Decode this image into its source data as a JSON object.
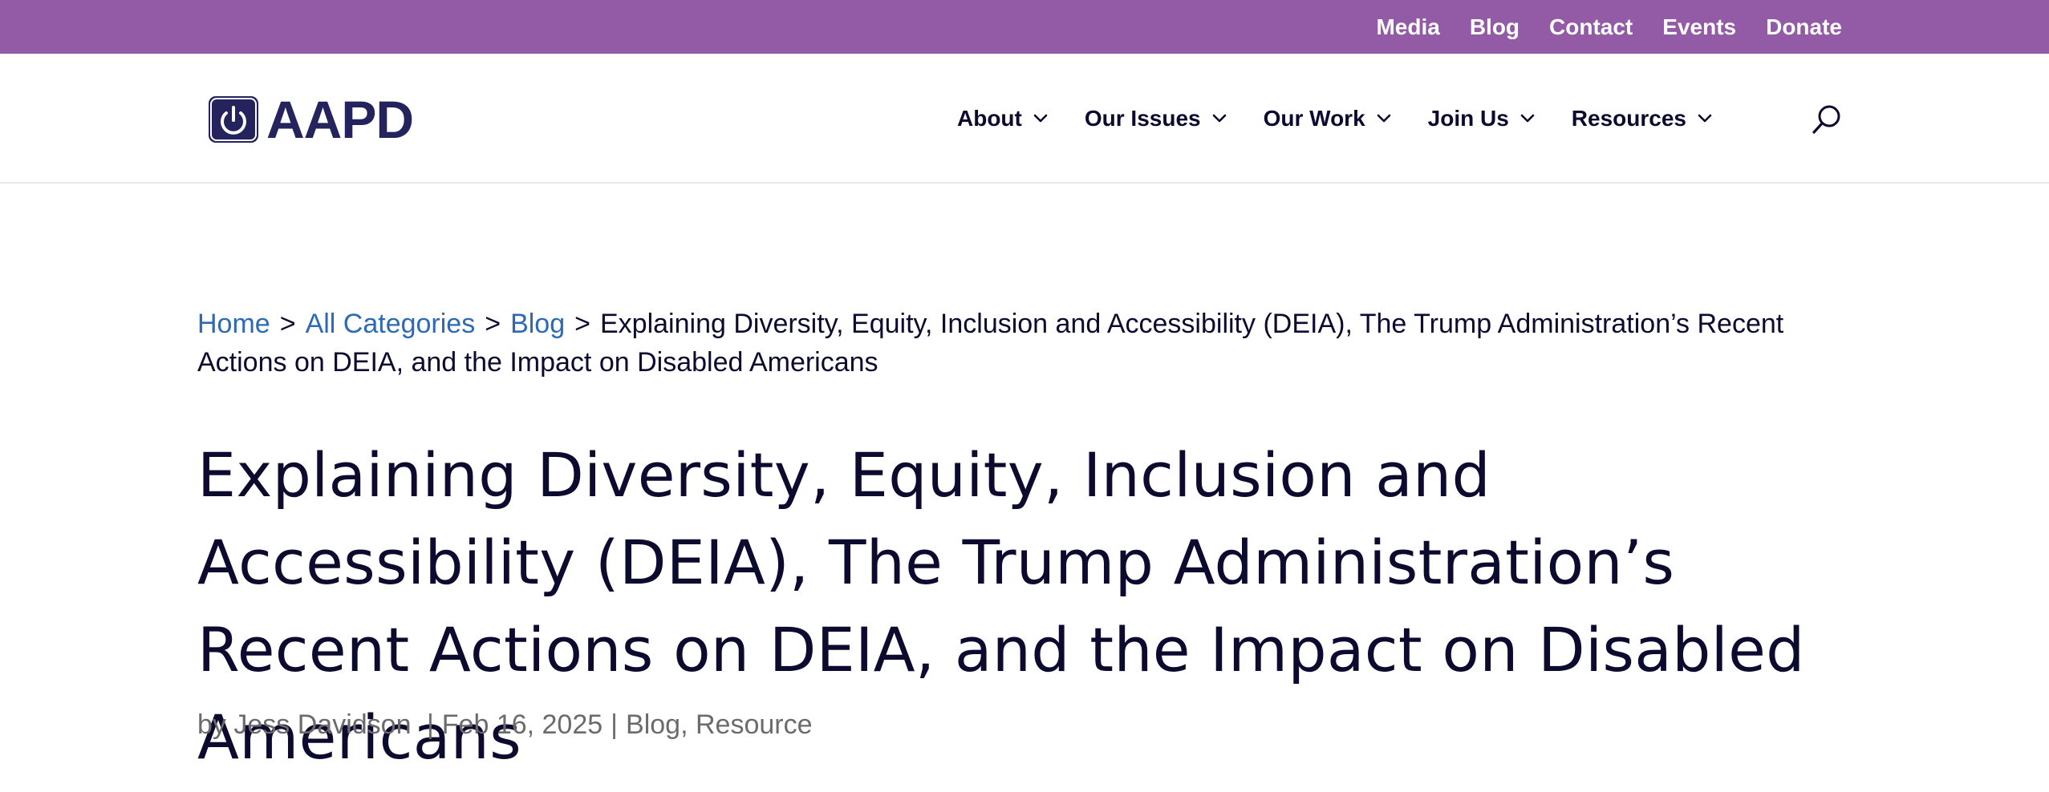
{
  "topbar": {
    "links": [
      "Media",
      "Blog",
      "Contact",
      "Events",
      "Donate"
    ],
    "background": "#935aa5"
  },
  "header": {
    "logo_text": "AAPD",
    "logo_icon": "power-icon",
    "nav": [
      {
        "label": "About",
        "icon": "chevron-down-icon"
      },
      {
        "label": "Our Issues",
        "icon": "chevron-down-icon"
      },
      {
        "label": "Our Work",
        "icon": "chevron-down-icon"
      },
      {
        "label": "Join Us",
        "icon": "chevron-down-icon"
      },
      {
        "label": "Resources",
        "icon": "chevron-down-icon"
      }
    ],
    "search_icon": "search-icon"
  },
  "breadcrumb": {
    "home": "Home",
    "categories": "All Categories",
    "blog": "Blog",
    "separator": ">",
    "current": "Explaining Diversity, Equity, Inclusion and Accessibility (DEIA), The Trump Administration’s Recent Actions on DEIA, and the Impact on Disabled Americans"
  },
  "article": {
    "title": "Explaining Diversity, Equity, Inclusion and Accessibility (DEIA), The Trump Administration’s Recent Actions on DEIA, and the Impact on Disabled Americans",
    "by_prefix": "by",
    "author": "Jess Davidson",
    "date": "Feb 16, 2025",
    "separator": "|",
    "category_1": "Blog",
    "category_2": "Resource"
  },
  "colors": {
    "accent_purple": "#935aa5",
    "navy": "#24235d",
    "text_dark": "#0c0a2e",
    "link_blue": "#2d6ab3",
    "meta_gray": "#6b6b6b"
  }
}
